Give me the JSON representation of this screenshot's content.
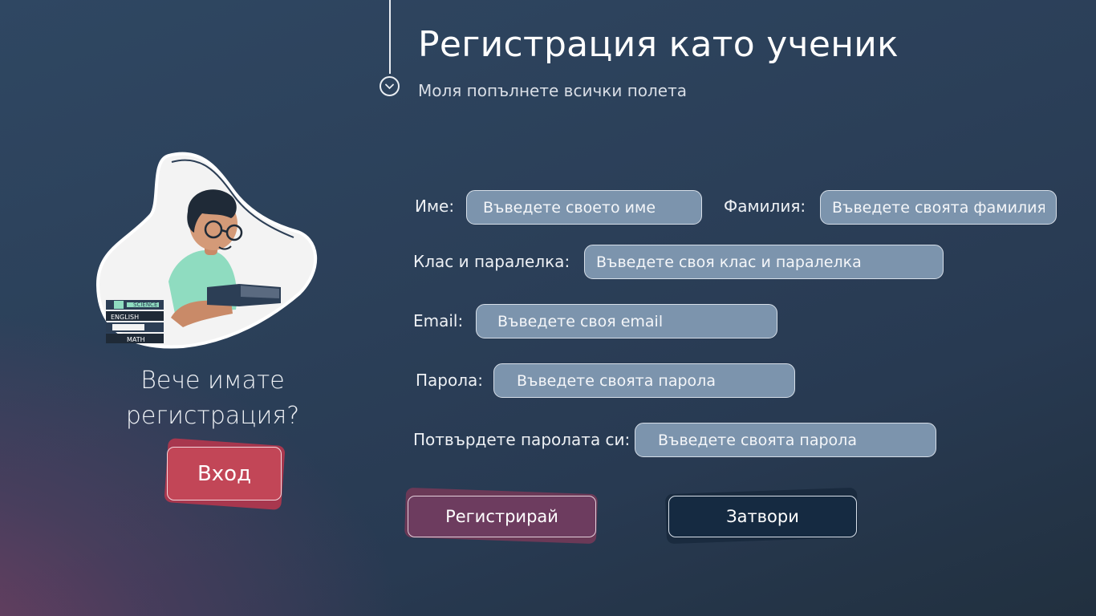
{
  "header": {
    "title": "Регистрация като ученик",
    "subtitle": "Моля попълнете всички полета"
  },
  "sidebar": {
    "have_account_line1": "Вече имате",
    "have_account_line2": "регистрация?",
    "login_label": "Вход",
    "illustration_icon": "student-reading-illustration",
    "book_labels": [
      "SCIENCE",
      "ENGLISH",
      "MATH"
    ]
  },
  "form": {
    "first_name": {
      "label": "Име:",
      "placeholder": "Въведете своето име"
    },
    "last_name": {
      "label": "Фамилия:",
      "placeholder": "Въведете своята фамилия"
    },
    "class": {
      "label": "Клас и паралелка:",
      "placeholder": "Въведете своя клас и паралелка"
    },
    "email": {
      "label": "Email:",
      "placeholder": "Въведете своя email"
    },
    "password": {
      "label": "Парола:",
      "placeholder": "Въведете своята парола"
    },
    "confirm_password": {
      "label": "Потвърдете паролата си:",
      "placeholder": "Въведете своята парола"
    }
  },
  "actions": {
    "register_label": "Регистрирай",
    "close_label": "Затвори"
  },
  "colors": {
    "accent_login": "#c24657",
    "register": "#6d3c5f",
    "close": "#152a41",
    "field": "#7c94ad"
  }
}
